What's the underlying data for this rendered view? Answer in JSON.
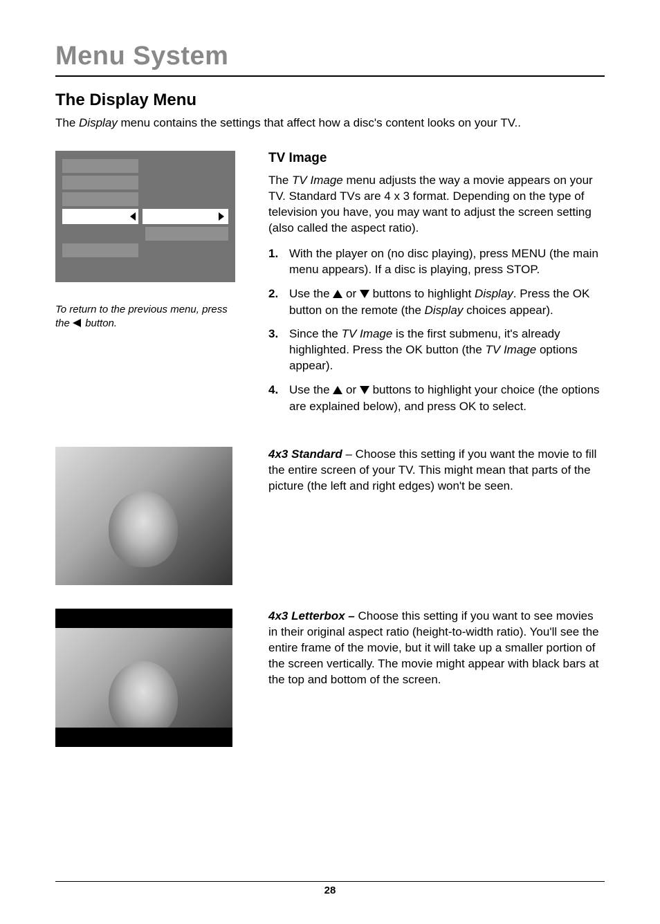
{
  "chapter_title": "Menu System",
  "section_title": "The Display Menu",
  "intro_text_pre": "The ",
  "intro_text_em": "Display",
  "intro_text_post": " menu contains the settings that affect how a disc's content looks on your TV..",
  "caption_pre": "To return to the previous menu, press the ",
  "caption_post": " button.",
  "tv_image": {
    "title": "TV Image",
    "para_pre": "The ",
    "para_em": "TV Image",
    "para_post": " menu adjusts the way a movie appears on your TV. Standard TVs are 4 x 3 format. Depending on the type of television you have, you may want to adjust the screen setting (also called the aspect ratio).",
    "steps": [
      {
        "num": "1.",
        "text": "With the player on (no disc playing), press MENU (the main menu appears). If a disc is playing, press STOP."
      },
      {
        "num": "2.",
        "pre": "Use the ",
        "mid": " or ",
        "post_pre": " buttons to highlight ",
        "post_em": "Display",
        "post_post": ". Press the OK button on the remote (the ",
        "post_em2": "Display",
        "post_tail": " choices appear)."
      },
      {
        "num": "3.",
        "pre": "Since the ",
        "em1": "TV Image",
        "mid": " is the first submenu, it's already highlighted. Press the OK button (the ",
        "em2": "TV Image",
        "post": " options appear)."
      },
      {
        "num": "4.",
        "pre": "Use the ",
        "mid": " or ",
        "post": " buttons to highlight your choice (the options are explained below), and press OK to select."
      }
    ]
  },
  "std_label": "4x3 Standard",
  "std_text": " – Choose this setting if you want the movie to fill the entire screen of your TV. This might mean that parts of the picture (the left and right edges) won't be seen.",
  "lbx_label": "4x3 Letterbox –",
  "lbx_text": " Choose this setting if you want to see movies in their original aspect ratio (height-to-width ratio). You'll see the entire frame of the movie, but it will take up a smaller portion of the screen vertically. The movie might appear with black bars at the top and bottom of the screen.",
  "page_number": "28"
}
